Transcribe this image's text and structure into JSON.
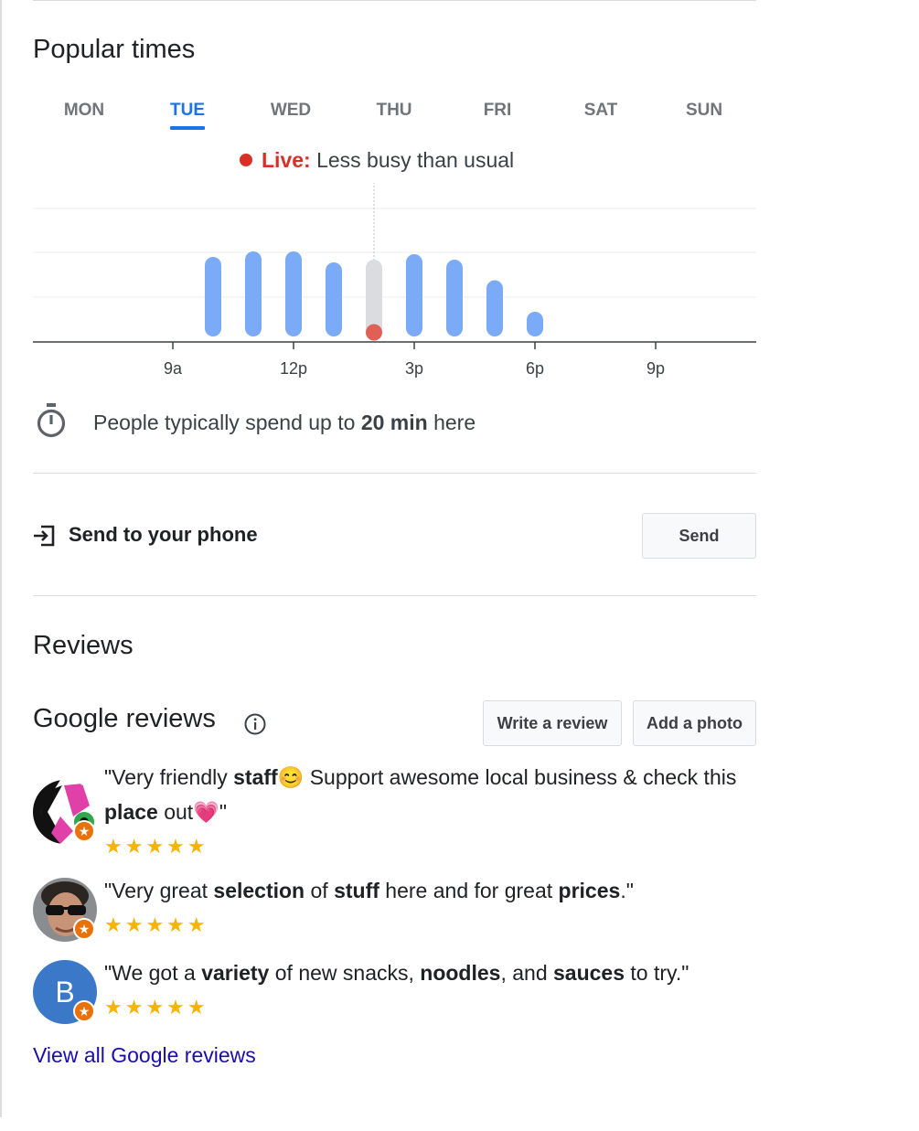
{
  "popular_times": {
    "title": "Popular times",
    "days": [
      "MON",
      "TUE",
      "WED",
      "THU",
      "FRI",
      "SAT",
      "SUN"
    ],
    "selected_day": "TUE",
    "live_label": "Live:",
    "live_text": "Less busy than usual",
    "time_spent_prefix": "People typically spend up to",
    "time_spent_value": "20 min",
    "time_spent_suffix": "here"
  },
  "chart_data": {
    "type": "bar",
    "categories": [
      "10a",
      "11a",
      "12p",
      "1p",
      "2p",
      "3p",
      "4p",
      "5p",
      "6p"
    ],
    "values": [
      62,
      66,
      66,
      58,
      60,
      64,
      60,
      45,
      22
    ],
    "live_category": "2p",
    "live_value": 10,
    "x_tick_labels": [
      "9a",
      "12p",
      "3p",
      "6p",
      "9p"
    ],
    "ylim": [
      0,
      100
    ],
    "colors": {
      "bar": "#7baaf7",
      "current_bar": "#dadce0",
      "live": "#e06055"
    }
  },
  "send": {
    "label": "Send to your phone",
    "button": "Send"
  },
  "reviews": {
    "heading": "Reviews",
    "google_heading": "Google reviews",
    "write_button": "Write a review",
    "photo_button": "Add a photo",
    "items": [
      {
        "text_parts": [
          {
            "t": "\"Very friendly ",
            "b": false
          },
          {
            "t": "staff",
            "b": true
          },
          {
            "t": "😊 Support awesome local business & check this ",
            "b": false
          },
          {
            "t": "place",
            "b": true
          },
          {
            "t": " out💗\"",
            "b": false
          }
        ],
        "stars": "★★★★★",
        "avatar": "pattern"
      },
      {
        "text_parts": [
          {
            "t": "\"Very great ",
            "b": false
          },
          {
            "t": "selection",
            "b": true
          },
          {
            "t": " of ",
            "b": false
          },
          {
            "t": "stuff",
            "b": true
          },
          {
            "t": " here and for great ",
            "b": false
          },
          {
            "t": "prices",
            "b": true
          },
          {
            "t": ".\"",
            "b": false
          }
        ],
        "stars": "★★★★★",
        "avatar": "photo"
      },
      {
        "text_parts": [
          {
            "t": "\"We got a ",
            "b": false
          },
          {
            "t": "variety",
            "b": true
          },
          {
            "t": " of new snacks, ",
            "b": false
          },
          {
            "t": "noodles",
            "b": true
          },
          {
            "t": ", and ",
            "b": false
          },
          {
            "t": "sauces",
            "b": true
          },
          {
            "t": " to try.\"",
            "b": false
          }
        ],
        "stars": "★★★★★",
        "avatar": "letter",
        "avatar_letter": "B",
        "avatar_color": "#3b78c8"
      }
    ],
    "view_all": "View all Google reviews"
  }
}
